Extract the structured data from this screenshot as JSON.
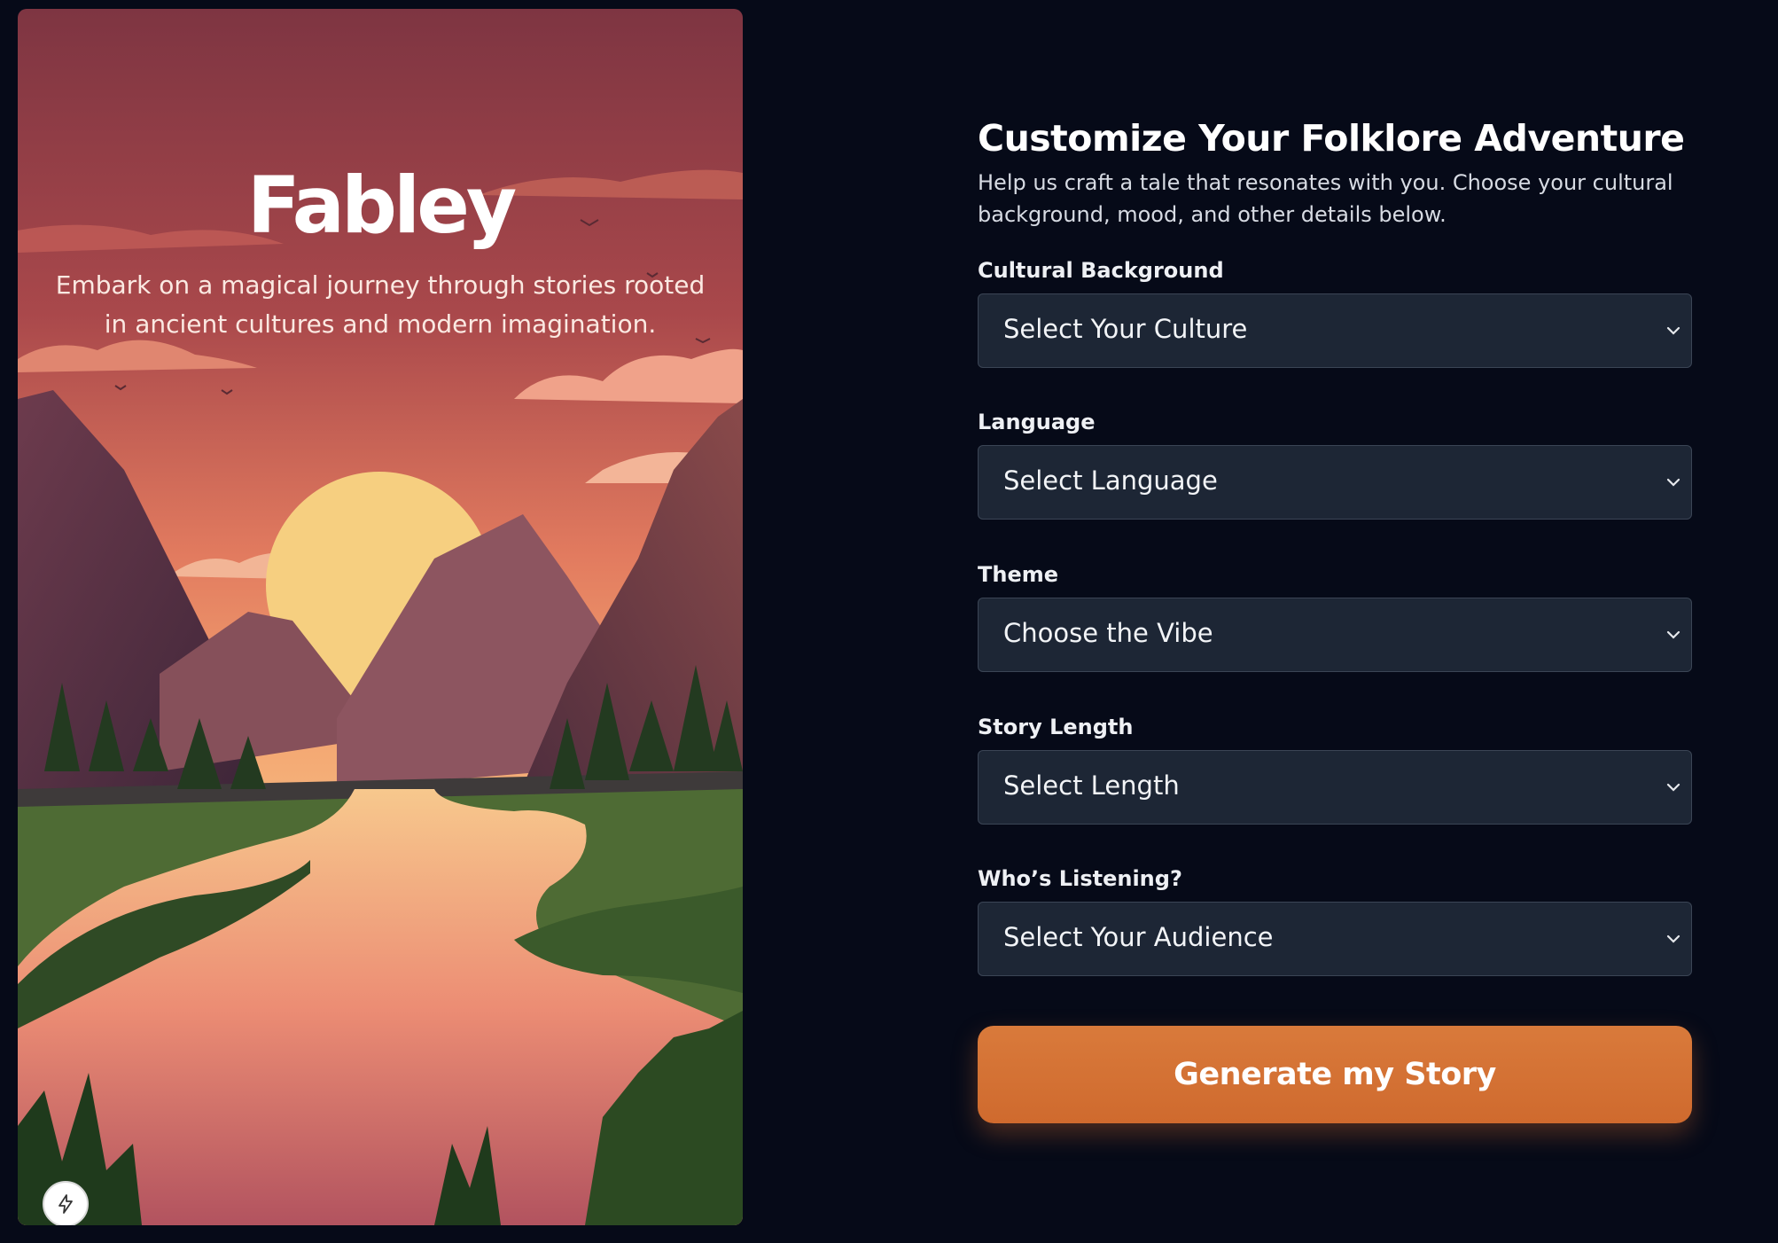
{
  "hero": {
    "brand": "Fabley",
    "tagline": "Embark on a magical journey through stories rooted in ancient cultures and modern imagination."
  },
  "form": {
    "title": "Customize Your Folklore Adventure",
    "subtitle": "Help us craft a tale that resonates with you. Choose your cultural background, mood, and other details below.",
    "fields": [
      {
        "label": "Cultural Background",
        "value": "Select Your Culture"
      },
      {
        "label": "Language",
        "value": "Select Language"
      },
      {
        "label": "Theme",
        "value": "Choose the Vibe"
      },
      {
        "label": "Story Length",
        "value": "Select Length"
      },
      {
        "label": "Who’s Listening?",
        "value": "Select Your Audience"
      }
    ],
    "submit_label": "Generate my Story"
  },
  "icons": {
    "dropdown": "chevron-down-icon",
    "corner_badge": "lightning-bolt-icon"
  },
  "colors": {
    "page_background": "#060a18",
    "select_background": "#1d2635",
    "accent": "#d4702f",
    "sky_top": "#7e3542",
    "sun": "#f6cf80"
  }
}
